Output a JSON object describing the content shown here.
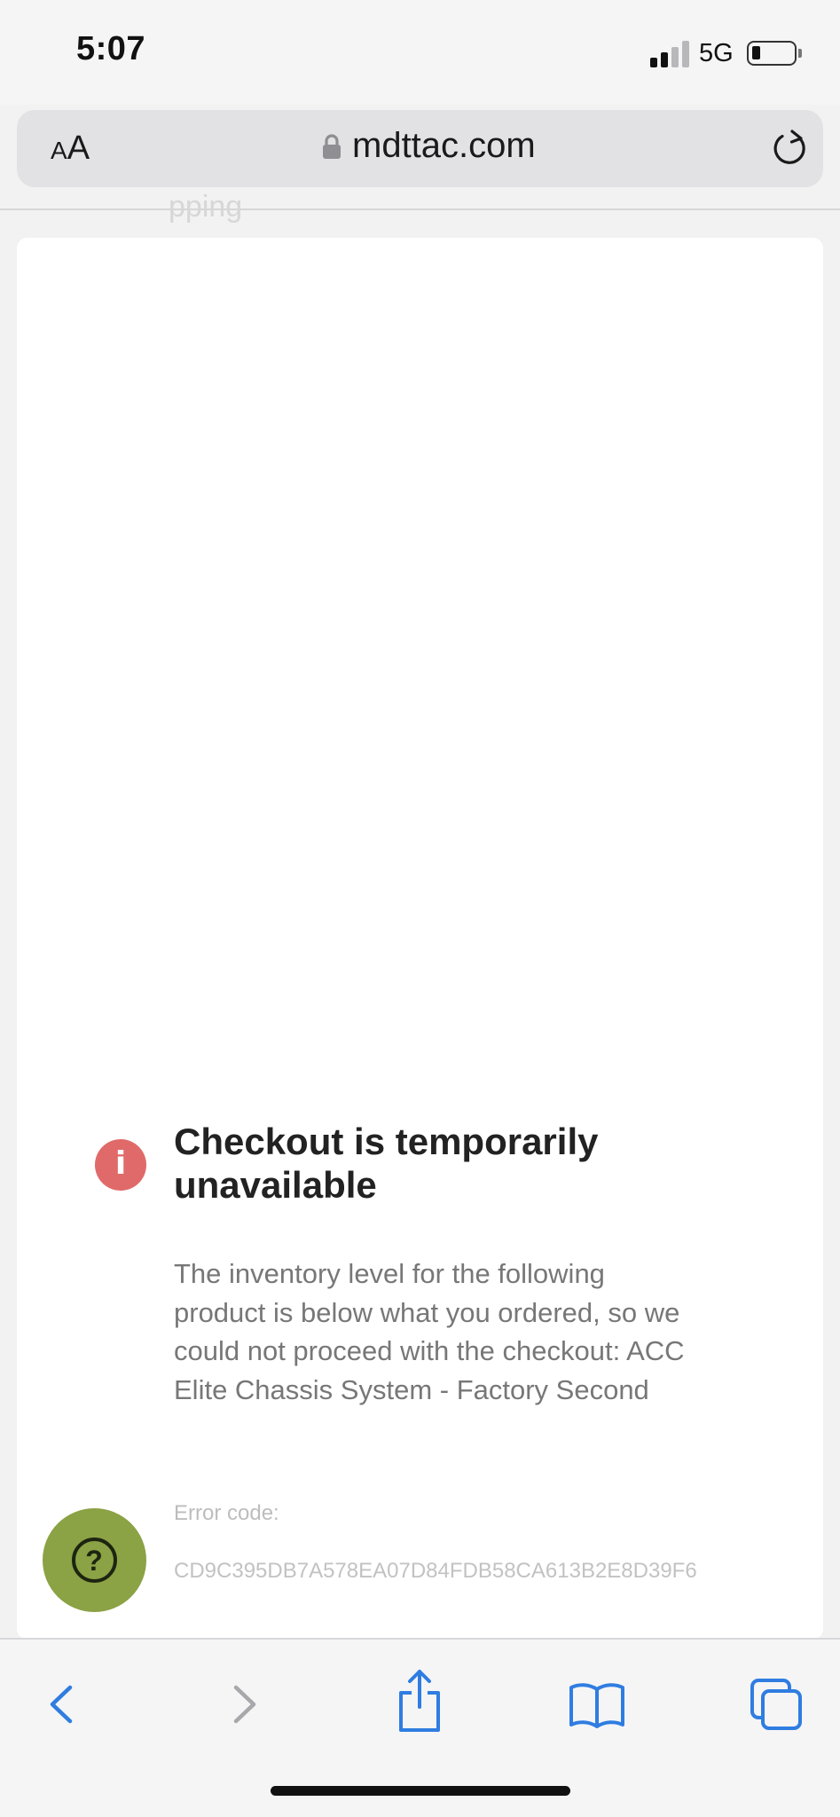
{
  "status_bar": {
    "time": "5:07",
    "network": "5G",
    "signal_bars_active": 2,
    "signal_bars_total": 4,
    "battery_level": 0.15
  },
  "browser": {
    "reader_label_small": "A",
    "reader_label_large": "A",
    "url": "mdttac.com",
    "icons": {
      "lock": "lock-icon",
      "reload": "reload-icon",
      "back": "chevron-left-icon",
      "forward": "chevron-right-icon",
      "share": "share-icon",
      "bookmarks": "book-icon",
      "tabs": "tabs-icon"
    }
  },
  "page": {
    "partial_text_top": "pping",
    "error": {
      "title": "Checkout is temporarily unavailable",
      "message": "The inventory level for the following product is below what you ordered, so we could not proceed with the checkout: ACC Elite Chassis System - Factory Second",
      "code_label": "Error code:",
      "code_value": "CD9C395DB7A578EA07D84FDB58CA613B2E8D39F6"
    },
    "help_button": {
      "icon": "question-mark-icon",
      "glyph": "?"
    }
  },
  "colors": {
    "error_icon": "#e06a6a",
    "help_button": "#8ba245",
    "toolbar_accent": "#2f7de1",
    "toolbar_disabled": "#a8a8ac"
  }
}
